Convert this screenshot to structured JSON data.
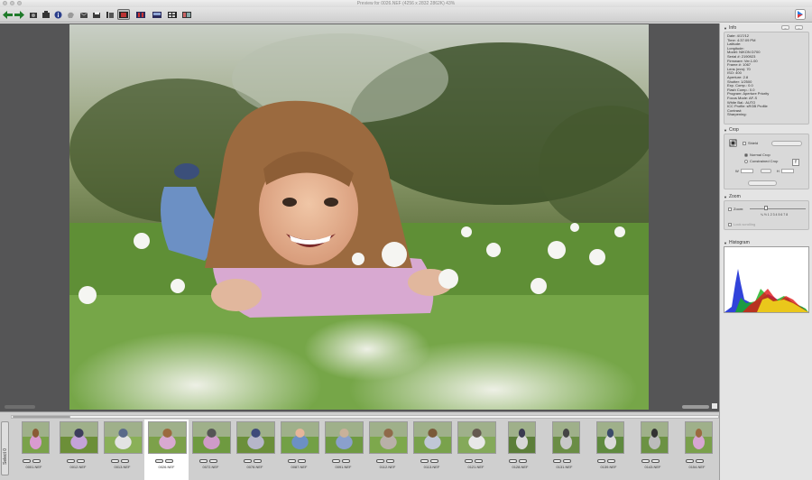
{
  "window": {
    "title": "Preview for 0026.NEF (4256 x 2832 2862K) 43%"
  },
  "toolbar": {
    "icons": [
      "back-arrow-icon",
      "forward-arrow-icon",
      "rotate-icon",
      "crop-icon",
      "info-icon",
      "hand-icon",
      "mail-icon",
      "folder-icon",
      "layout-single-icon",
      "layout-selected-icon",
      "layout-compare-icon",
      "layout-film-icon",
      "layout-grid-icon",
      "layout-multi-icon",
      "app-logo-icon"
    ]
  },
  "panel": {
    "info": {
      "title": "Info",
      "lines": [
        "Date: 4/17/12",
        "Time: 4:37:09 PM",
        "Latitude:",
        "Longitude:",
        "Model: NIKON D700",
        "Serial #: 2190923",
        "Firmware: Ver.1.00",
        "Frame #: 1067",
        "Lens (mm): 70",
        "ISO: 400",
        "Aperture: 2.8",
        "Shutter: 1/2500",
        "Exp. Comp.: 0.0",
        "Flash Comp.: 0.0",
        "Program: Aperture Priority",
        "Focus Mode: AF-S",
        "White Bal.: AUTO",
        "ICC Profile: sRGB Profile",
        "Contrast:",
        "Sharpening:"
      ]
    },
    "crop": {
      "title": "Crop",
      "shield_label": "Shield",
      "normal_crop_label": "Normal Crop",
      "constrained_crop_label": "Constrained Crop",
      "w_label": "W",
      "h_label": "H"
    },
    "zoom": {
      "title": "Zoom",
      "zoom_label": "Zoom:",
      "scale": "¼ ½ 1 2 3 4 5 6 7 8",
      "lock_label": "Lock scrolling"
    },
    "histogram": {
      "title": "Histogram"
    }
  },
  "filmstrip": {
    "tab_label": "Select 0",
    "selected_index": 3,
    "items": [
      {
        "name": "0001.NEF",
        "orientation": "portrait"
      },
      {
        "name": "0012.NEF",
        "orientation": "landscape"
      },
      {
        "name": "0013.NEF",
        "orientation": "landscape"
      },
      {
        "name": "0026.NEF",
        "orientation": "landscape"
      },
      {
        "name": "0072.NEF",
        "orientation": "landscape"
      },
      {
        "name": "0078.NEF",
        "orientation": "landscape"
      },
      {
        "name": "0087.NEF",
        "orientation": "landscape"
      },
      {
        "name": "0091.NEF",
        "orientation": "landscape"
      },
      {
        "name": "0112.NEF",
        "orientation": "landscape"
      },
      {
        "name": "0113.NEF",
        "orientation": "landscape"
      },
      {
        "name": "0121.NEF",
        "orientation": "landscape"
      },
      {
        "name": "0128.NEF",
        "orientation": "portrait"
      },
      {
        "name": "0131.NEF",
        "orientation": "portrait"
      },
      {
        "name": "0139.NEF",
        "orientation": "portrait"
      },
      {
        "name": "0143.NEF",
        "orientation": "portrait"
      },
      {
        "name": "0154.NEF",
        "orientation": "portrait"
      }
    ]
  }
}
